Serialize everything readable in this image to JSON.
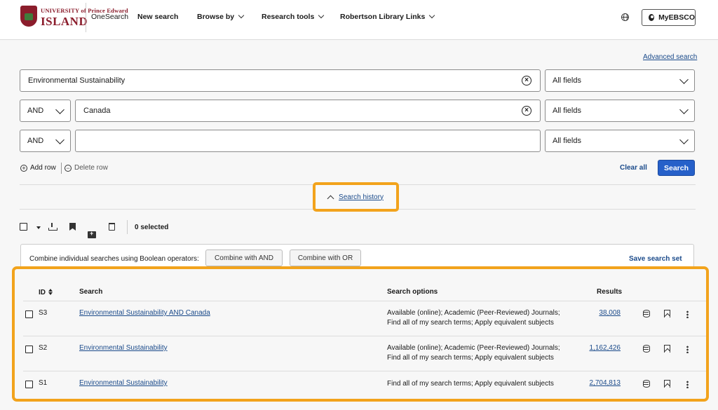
{
  "header": {
    "logo_line1": "UNIVERSITY of Prince Edward",
    "logo_line2": "ISLAND",
    "app_name": "OneSearch",
    "nav": [
      "New search",
      "Browse by",
      "Research tools",
      "Robertson Library Links"
    ],
    "account_label": "MyEBSCO"
  },
  "search_form": {
    "advanced_link": "Advanced search",
    "rows": [
      {
        "operator": "",
        "term": "Environmental Sustainability",
        "field": "All fields"
      },
      {
        "operator": "AND",
        "term": "Canada",
        "field": "All fields"
      },
      {
        "operator": "AND",
        "term": "",
        "field": "All fields"
      }
    ],
    "clear_glyph": "×",
    "add_row": "Add row",
    "delete_row": "Delete row",
    "add_glyph": "+",
    "delete_glyph": "−",
    "clear_all": "Clear all",
    "search_button": "Search"
  },
  "history_toggle": {
    "label": "Search history"
  },
  "toolbar": {
    "selected_text": "0 selected"
  },
  "combine": {
    "instruction": "Combine individual searches using Boolean operators:",
    "and_button": "Combine with AND",
    "or_button": "Combine with OR",
    "save_set": "Save search set"
  },
  "history_table": {
    "headers": {
      "id": "ID",
      "search": "Search",
      "options": "Search options",
      "results": "Results"
    },
    "rows": [
      {
        "id": "S3",
        "search": "Environmental Sustainability AND Canada",
        "options_line1": "Available (online); Academic (Peer-Reviewed) Journals;",
        "options_line2": "Find all of my search terms; Apply equivalent subjects",
        "results": "38,008"
      },
      {
        "id": "S2",
        "search": "Environmental Sustainability",
        "options_line1": "Available (online); Academic (Peer-Reviewed) Journals;",
        "options_line2": "Find all of my search terms; Apply equivalent subjects",
        "results": "1,162,426"
      },
      {
        "id": "S1",
        "search": "Environmental Sustainability",
        "options_line1": "Find all of my search terms; Apply equivalent subjects",
        "options_line2": "",
        "results": "2,704,813"
      }
    ]
  },
  "colors": {
    "accent": "#2660c9",
    "highlight": "#f2a31c",
    "brand": "#8b1d2c",
    "link": "#1a4a8a"
  },
  "icons": [
    "globe-icon",
    "user-icon",
    "clear-icon",
    "chevron-down-icon",
    "add-circle-icon",
    "remove-circle-icon",
    "chevron-up-icon",
    "download-icon",
    "bookmark-icon",
    "folder-add-icon",
    "trash-icon",
    "sort-icon",
    "database-icon",
    "kebab-icon"
  ]
}
